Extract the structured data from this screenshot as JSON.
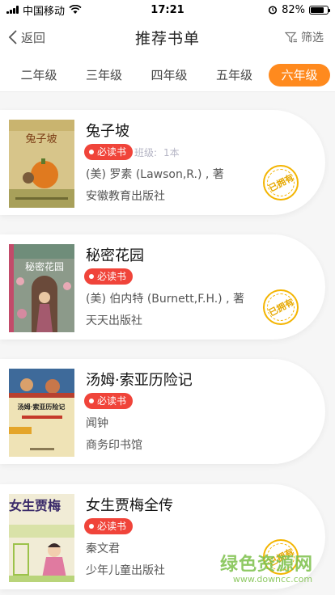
{
  "status_bar": {
    "carrier": "中国移动",
    "time": "17:21",
    "battery": "82%",
    "battery_level": 0.82,
    "icons": [
      "signal-icon",
      "wifi-icon",
      "alarm-icon",
      "battery-icon"
    ]
  },
  "nav": {
    "back_label": "返回",
    "title": "推荐书单",
    "filter_label": "筛选",
    "icons": [
      "chevron-left-icon",
      "filter-icon"
    ]
  },
  "grade_tabs": [
    {
      "label": "二年级",
      "active": false
    },
    {
      "label": "三年级",
      "active": false
    },
    {
      "label": "四年级",
      "active": false
    },
    {
      "label": "五年级",
      "active": false
    },
    {
      "label": "六年级",
      "active": true
    }
  ],
  "books": [
    {
      "title": "兔子坡",
      "badge": "必读书",
      "class_label": "班级:",
      "class_value": "1本",
      "author": "(美) 罗素 (Lawson,R.) , 著",
      "publisher": "安徽教育出版社",
      "owned": true,
      "owned_label": "已拥有",
      "cover_text": "兔子坡"
    },
    {
      "title": "秘密花园",
      "badge": "必读书",
      "author": "(美) 伯内特 (Burnett,F.H.) , 著",
      "publisher": "天天出版社",
      "owned": true,
      "owned_label": "已拥有",
      "cover_text": "秘密花园"
    },
    {
      "title": "汤姆·索亚历险记",
      "badge": "必读书",
      "author": "闻钟",
      "publisher": "商务印书馆",
      "owned": false,
      "cover_text": "汤姆·索亚历险记"
    },
    {
      "title": "女生贾梅全传",
      "badge": "必读书",
      "author": "秦文君",
      "publisher": "少年儿童出版社",
      "owned": true,
      "owned_label": "已拥有",
      "cover_text": "女生贾梅"
    }
  ],
  "watermark": {
    "main": "绿色资源网",
    "sub": "www.downcc.com"
  },
  "colors": {
    "accent": "#ff8a1e",
    "badge": "#f0443a",
    "owned_stamp": "#f3b400"
  }
}
